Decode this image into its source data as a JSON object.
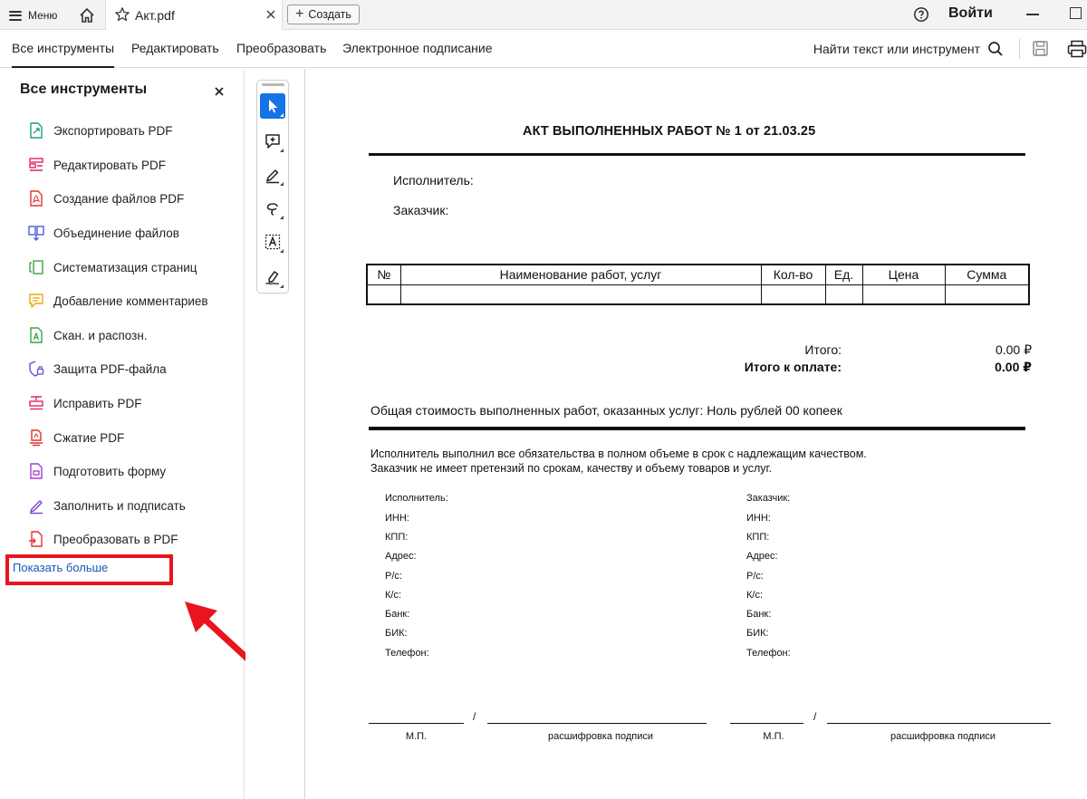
{
  "titlebar": {
    "menu_label": "Меню",
    "tab_title": "Акт.pdf",
    "create_label": "Создать",
    "login_label": "Войти"
  },
  "menubar": {
    "tabs": [
      {
        "label": "Все инструменты",
        "active": true
      },
      {
        "label": "Редактировать",
        "active": false
      },
      {
        "label": "Преобразовать",
        "active": false
      },
      {
        "label": "Электронное подписание",
        "active": false
      }
    ],
    "find_label": "Найти текст или инструмент"
  },
  "left_panel": {
    "title": "Все инструменты",
    "tools": [
      {
        "label": "Экспортировать PDF",
        "icon": "export-pdf-icon",
        "color": "#1f9e8f"
      },
      {
        "label": "Редактировать PDF",
        "icon": "edit-pdf-icon",
        "color": "#e0245e"
      },
      {
        "label": "Создание файлов PDF",
        "icon": "create-pdf-icon",
        "color": "#e3342f"
      },
      {
        "label": "Объединение файлов",
        "icon": "combine-files-icon",
        "color": "#4b5fd6"
      },
      {
        "label": "Систематизация страниц",
        "icon": "organize-pages-icon",
        "color": "#3ea34a"
      },
      {
        "label": "Добавление комментариев",
        "icon": "comment-icon",
        "color": "#e9a70b"
      },
      {
        "label": "Скан. и распозн.",
        "icon": "scan-ocr-icon",
        "color": "#3ea34a"
      },
      {
        "label": "Защита PDF-файла",
        "icon": "protect-icon",
        "color": "#6a4bd6"
      },
      {
        "label": "Исправить PDF",
        "icon": "redact-icon",
        "color": "#e0245e"
      },
      {
        "label": "Сжатие PDF",
        "icon": "compress-icon",
        "color": "#e3342f"
      },
      {
        "label": "Подготовить форму",
        "icon": "prepare-form-icon",
        "color": "#a23fd1"
      },
      {
        "label": "Заполнить и подписать",
        "icon": "fill-sign-icon",
        "color": "#7b3fd1"
      },
      {
        "label": "Преобразовать в PDF",
        "icon": "convert-pdf-icon",
        "color": "#e3342f"
      }
    ],
    "show_more": "Показать больше",
    "highlight_color": "#e8141e"
  },
  "document": {
    "title": "АКТ ВЫПОЛНЕННЫХ РАБОТ № 1 от 21.03.25",
    "executor_label": "Исполнитель:",
    "customer_label": "Заказчик:",
    "table": {
      "headers": [
        "№",
        "Наименование работ, услуг",
        "Кол-во",
        "Ед.",
        "Цена",
        "Сумма"
      ],
      "rows": [
        [
          "",
          "",
          "",
          "",
          "",
          ""
        ]
      ]
    },
    "total_label": "Итого:",
    "total_value": "0.00 ₽",
    "to_pay_label": "Итого к оплате:",
    "to_pay_value": "0.00 ₽",
    "cost_line": "Общая стоимость выполненных работ, оказанных услуг: Ноль рублей 00 копеек",
    "statement_1": "Исполнитель выполнил все обязательства в полном объеме в срок с надлежащим качеством.",
    "statement_2": "Заказчик не имеет претензий по срокам, качеству и объему товаров и услуг.",
    "executor_req": [
      "Исполнитель:",
      "ИНН:",
      "КПП:",
      "Адрес:",
      "Р/с:",
      "К/с:",
      "Банк:",
      "БИК:",
      "Телефон:"
    ],
    "customer_req": [
      "Заказчик:",
      "ИНН:",
      "КПП:",
      "Адрес:",
      "Р/с:",
      "К/с:",
      "Банк:",
      "БИК:",
      "Телефон:"
    ],
    "stamp_label": "М.П.",
    "signature_label": "расшифровка подписи",
    "slash": "/"
  }
}
